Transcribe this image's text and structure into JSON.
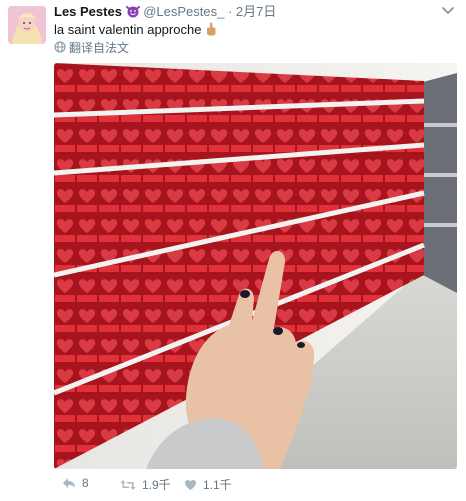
{
  "tweet": {
    "author_name": "Les Pestes",
    "author_handle": "@LesPestes_",
    "separator": "·",
    "date": "2月7日",
    "text": "la saint valentin approche",
    "translate_label": "翻译自法文",
    "photo_alt": "Rayon de chocolats de la Saint-Valentin en supermarché",
    "name_emoji_icon": "purple-devil-emoji-icon",
    "text_emoji_icon": "middle-finger-emoji-icon"
  },
  "actions": {
    "reply_count": "8",
    "retweet_count": "1.9千",
    "like_count": "1.1千"
  },
  "colors": {
    "text_primary": "#14171a",
    "text_secondary": "#657786",
    "shelf_red": "#c8202b"
  }
}
